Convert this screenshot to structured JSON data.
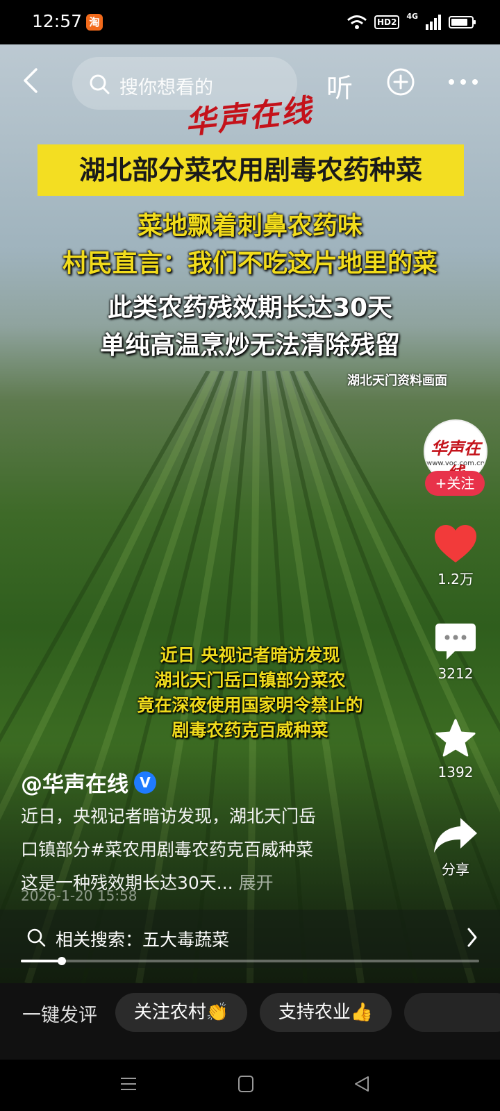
{
  "status_bar": {
    "time": "12:57",
    "app_badge": "淘",
    "network_badge": "HD2",
    "signal_label": "4G",
    "battery_level": 0.85
  },
  "top_nav": {
    "search_placeholder": "搜你想看的",
    "listen_label": "听"
  },
  "video": {
    "watermark": "华声在线",
    "headline": "湖北部分菜农用剧毒农药种菜",
    "subtitle_lines": [
      "菜地飘着刺鼻农药味",
      "村民直言：我们不吃这片地里的菜"
    ],
    "info_lines": [
      "此类农药残效期长达30天",
      "单纯高温烹炒无法清除残留"
    ],
    "source_tag": "湖北天门资料画面",
    "field_caption": [
      "近日 央视记者暗访发现",
      "湖北天门岳口镇部分菜农",
      "竟在深夜使用国家明令禁止的",
      "剧毒农药克百威种菜"
    ]
  },
  "actions": {
    "avatar_text": "华声在线",
    "avatar_url": "www.voc.com.cn",
    "follow_label": "+关注",
    "like_count": "1.2万",
    "comment_count": "3212",
    "favorite_count": "1392",
    "share_label": "分享"
  },
  "post": {
    "author": "@华声在线",
    "verified_badge": "V",
    "description_lines": [
      "近日，央视记者暗访发现，湖北天门岳",
      "口镇部分#菜农用剧毒农药克百威种菜",
      "这是一种残效期长达30天..."
    ],
    "expand_label": "展开",
    "date": "2026-1-20 15:58"
  },
  "related_search": {
    "text": "相关搜索：五大毒蔬菜"
  },
  "playback": {
    "progress": 0.09
  },
  "quick_comment": {
    "label": "一键发评",
    "chips": [
      "关注农村👏",
      "支持农业👍"
    ]
  },
  "colors": {
    "accent_red": "#e8324a",
    "caption_yellow": "#f2dc1c",
    "headline_bg": "#f3de22"
  }
}
